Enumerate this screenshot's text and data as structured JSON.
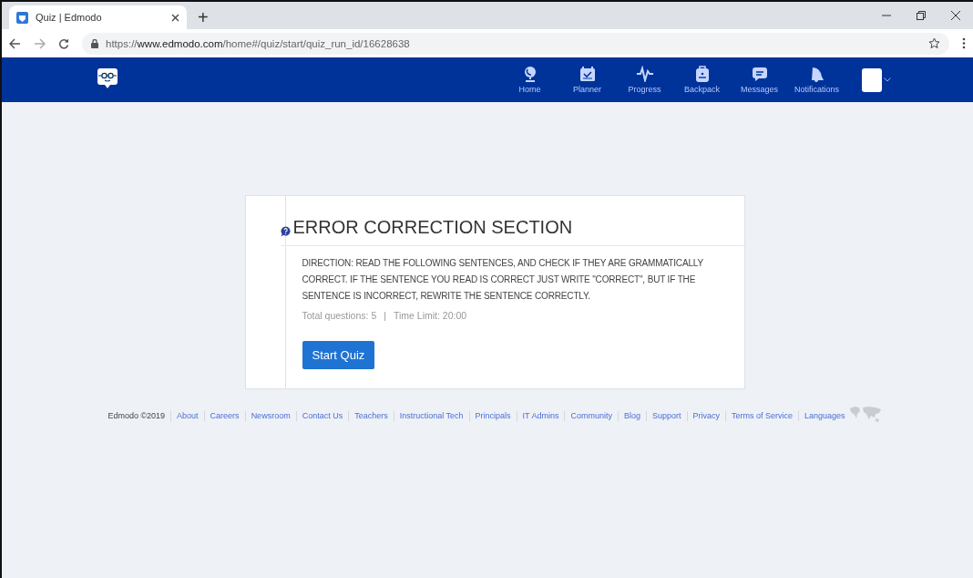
{
  "browser": {
    "tab_title": "Quiz | Edmodo",
    "new_tab": "+",
    "url": {
      "scheme": "https://",
      "host": "www.edmodo.com",
      "path": "/home#/quiz/start/quiz_run_id/16628638"
    }
  },
  "nav": {
    "items": [
      {
        "label": "Home",
        "kind": "home"
      },
      {
        "label": "Planner",
        "kind": "planner"
      },
      {
        "label": "Progress",
        "kind": "progress"
      },
      {
        "label": "Backpack",
        "kind": "backpack"
      },
      {
        "label": "Messages",
        "kind": "messages"
      },
      {
        "label": "Notifications",
        "kind": "notifications"
      }
    ]
  },
  "quiz": {
    "title": "ERROR CORRECTION SECTION",
    "direction": "DIRECTION: READ THE FOLLOWING SENTENCES, AND CHECK IF THEY ARE GRAMMATICALLY CORRECT. IF THE SENTENCE YOU READ IS CORRECT JUST WRITE \"CORRECT\", BUT IF THE SENTENCE IS INCORRECT, REWRITE THE SENTENCE CORRECTLY.",
    "total_questions": "Total questions: 5",
    "separator": "|",
    "time_limit": "Time Limit: 20:00",
    "start_button": "Start Quiz"
  },
  "footer": {
    "copyright": "Edmodo ©2019",
    "links": [
      "About",
      "Careers",
      "Newsroom",
      "Contact Us",
      "Teachers",
      "Instructional Tech",
      "Principals",
      "IT Admins",
      "Community",
      "Blog",
      "Support",
      "Privacy",
      "Terms of Service",
      "Languages"
    ]
  }
}
